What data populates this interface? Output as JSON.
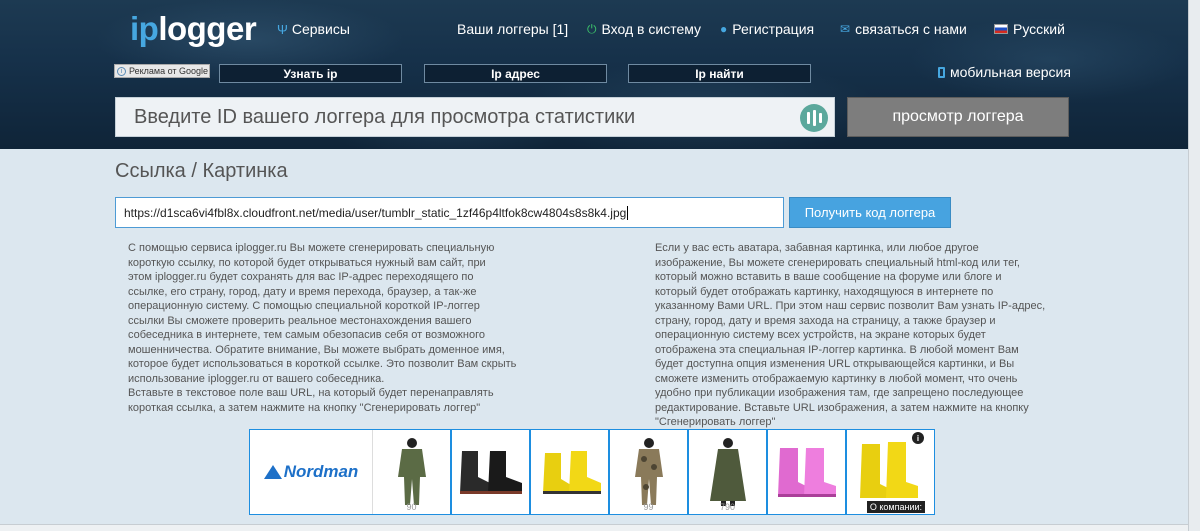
{
  "header": {
    "logo_ip": "ip",
    "logo_rest": "logger",
    "services": "Сервисы",
    "my_loggers": "Ваши логгеры [1]",
    "login": "Вход в систему",
    "register": "Регистрация",
    "contact": "связаться с нами",
    "language": "Русский"
  },
  "ads_row": {
    "ad_marker": "Реклама от Google",
    "links": [
      "Узнать ip",
      "Ip адрес",
      "Ip найти"
    ],
    "mobile": "мобильная версия"
  },
  "logger_search": {
    "placeholder": "Введите ID вашего логгера для просмотра статистики",
    "button": "просмотр логгера"
  },
  "main": {
    "title": "Ссылка / Картинка",
    "url_value": "https://d1sca6vi4fbl8x.cloudfront.net/media/user/tumblr_static_1zf46p4ltfok8cw4804s8s8k4.jpg",
    "get_code_button": "Получить код логгера",
    "desc_left": "С помощью сервиса iplogger.ru Вы можете сгенерировать специальную\nкороткую ссылку, по которой будет открываться нужный вам сайт, при\nэтом iplogger.ru будет сохранять для вас IP-адрес переходящего по\nссылке, его страну, город, дату и время перехода, браузер, а так-же\nоперационную систему. С помощью специальной короткой IP-логгер\nссылки Вы сможете проверить реальное местонахождения вашего\nсобеседника в интернете, тем самым обезопасив себя от возможного\nмошенничества. Обратите внимание, Вы можете выбрать доменное имя,\nкоторое будет использоваться в короткой ссылке. Это позволит Вам скрыть\nиспользование iplogger.ru от вашего собеседника.\nВставьте в текстовое поле ваш URL, на который будет перенаправлять\nкороткая ссылка, а затем нажмите на кнопку \"Сгенерировать логгер\"",
    "desc_right": "Если у вас есть аватара, забавная картинка, или любое другое\nизображение, Вы можете сгенерировать специальный html-код или тег,\nкоторый можно вставить в ваше сообщение на форуме или блоге и\nкоторый будет отображать картинку, находящуюся в интернете по\nуказанному Вами URL. При этом наш сервис позволит Вам узнать IP-адрес,\nстрану, город, дату и время захода на страницу, а также браузер и\nоперационную систему всех устройств, на экране которых будет\nотображена эта специальная IP-логгер картинка. В любой момент Вам\nбудет доступна опция изменения URL открывающейся картинки, и Вы\nсможете изменить отображаемую картинку в любой момент, что очень\nудобно при публикации изображения там, где запрещено последующее\nредактирование. Вставьте URL изображения, а затем нажмите на кнопку\n\"Сгенерировать логгер\""
  },
  "ad_banner": {
    "brand": "Nordman",
    "products": [
      {
        "name": "suit-olive",
        "price": "90"
      },
      {
        "name": "boots-black",
        "price": ""
      },
      {
        "name": "boots-yellow-low",
        "price": ""
      },
      {
        "name": "suit-camo",
        "price": "99"
      },
      {
        "name": "raincoat-olive",
        "price": "790"
      },
      {
        "name": "boots-pink",
        "price": ""
      },
      {
        "name": "boots-yellow-high",
        "price": ""
      }
    ],
    "about": "О компании:",
    "info_icon": "i"
  }
}
